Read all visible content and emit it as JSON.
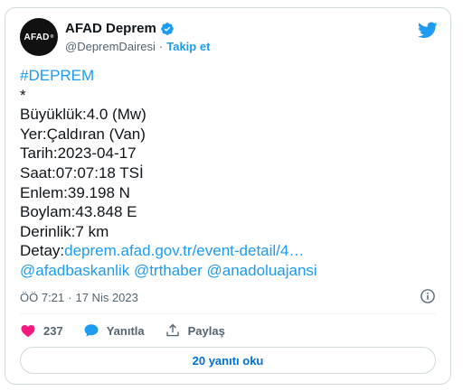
{
  "account": {
    "avatar_text": "AFAD",
    "name": "AFAD Deprem",
    "handle": "@DepremDairesi",
    "separator": "·",
    "follow_label": "Takip et"
  },
  "tweet": {
    "hashtag": "#DEPREM",
    "star": "*",
    "lines": [
      "Büyüklük:4.0 (Mw)",
      "Yer:Çaldıran (Van)",
      "Tarih:2023-04-17",
      "Saat:07:07:18 TSİ",
      "Enlem:39.198 N",
      "Boylam:43.848 E",
      "Derinlik:7 km"
    ],
    "detail_label": "Detay:",
    "detail_link": "deprem.afad.gov.tr/event-detail/4…",
    "mentions": "@afadbaskanlik @trthaber @anadoluajansi"
  },
  "meta": {
    "time": "ÖÖ 7:21",
    "separator": "·",
    "date": "17 Nis 2023"
  },
  "actions": {
    "like_count": "237",
    "reply_label": "Yanıtla",
    "share_label": "Paylaş"
  },
  "replies_button_label": "20 yanıtı oku",
  "colors": {
    "accent": "#1d9bf0",
    "like": "#f91880",
    "text": "#0f1419",
    "muted": "#536471",
    "border": "#cfd9de"
  },
  "icons": [
    "verified-badge-icon",
    "twitter-bird-icon",
    "info-icon",
    "heart-icon",
    "reply-bubble-icon",
    "share-icon"
  ]
}
